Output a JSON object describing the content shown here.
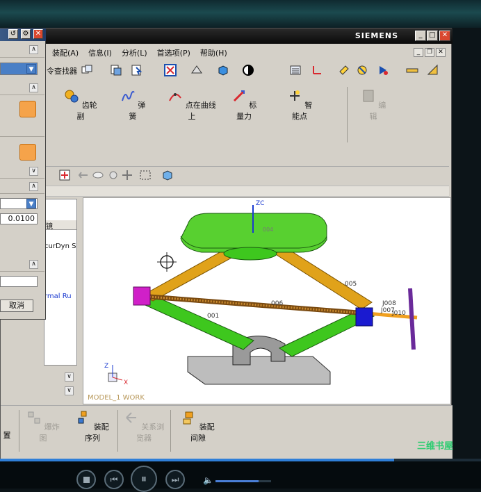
{
  "window": {
    "brand": "SIEMENS"
  },
  "menu": [
    "装配(A)",
    "信息(I)",
    "分析(L)",
    "首选项(P)",
    "帮助(H)"
  ],
  "toolbar": {
    "finder_label": "令查找器"
  },
  "main_tools": [
    {
      "label": "齿轮副",
      "icon": "gear-pair-icon"
    },
    {
      "label": "弹簧",
      "icon": "spring-icon"
    },
    {
      "label": "点在曲线上",
      "icon": "point-on-curve-icon"
    },
    {
      "label": "标量力",
      "icon": "scalar-force-icon"
    },
    {
      "label": "智能点",
      "icon": "smart-point-icon"
    },
    {
      "label": "编辑",
      "icon": "edit-icon",
      "disabled": true
    }
  ],
  "dialog": {
    "value": "0.0100",
    "cancel": "取消"
  },
  "navigator": {
    "header": "镜",
    "item1": "curDyn S",
    "item2": "rmal Ru"
  },
  "graphics": {
    "work_label": "MODEL_1 WORK",
    "axis_zc": "ZC",
    "axis_z": "Z",
    "axis_x": "X",
    "joint_labels": [
      "J008",
      "J007",
      "J010",
      "005",
      "006",
      "001",
      "004"
    ]
  },
  "bottom_tools": [
    {
      "label": "置",
      "icon": "position-icon",
      "disabled": false
    },
    {
      "label": "爆炸图",
      "icon": "exploded-view-icon",
      "disabled": true
    },
    {
      "label": "装配序列",
      "icon": "assembly-sequence-icon",
      "disabled": false
    },
    {
      "label": "关系浏览器",
      "icon": "relation-browser-icon",
      "disabled": true
    },
    {
      "label": "装配间隙",
      "icon": "assembly-clearance-icon",
      "disabled": false
    }
  ],
  "watermark": "三维书屋",
  "player": {
    "volume": 0.78,
    "progress": 0.82
  },
  "colors": {
    "accent": "#4a7fc6",
    "body_green": "#3ec71e",
    "arm_orange": "#e0a21a",
    "block_magenta": "#d020c8",
    "block_blue": "#1a1ad0"
  }
}
